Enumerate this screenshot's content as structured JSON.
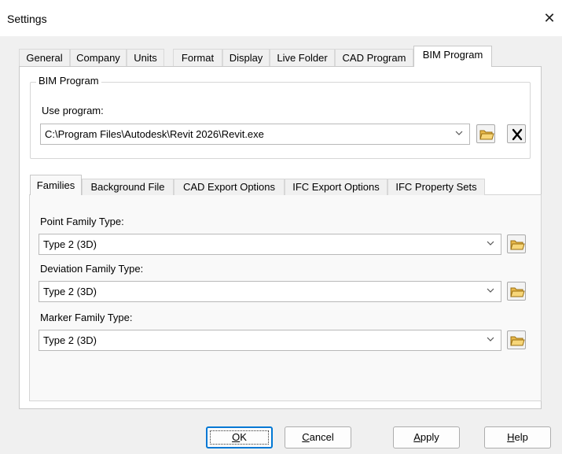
{
  "window": {
    "title": "Settings",
    "close_glyph": "✕"
  },
  "tabs": [
    "General",
    "Company",
    "Units",
    "Format",
    "Display",
    "Live Folder",
    "CAD Program",
    "BIM Program"
  ],
  "active_tab": "BIM Program",
  "bim_program": {
    "group_label": "BIM Program",
    "use_program_label": "Use program:",
    "program_path": "C:\\Program Files\\Autodesk\\Revit 2026\\Revit.exe"
  },
  "sub_tabs": [
    "Families",
    "Background File",
    "CAD Export Options",
    "IFC Export Options",
    "IFC Property Sets"
  ],
  "active_sub_tab": "Families",
  "families": {
    "point": {
      "label": "Point Family Type:",
      "value": "Type 2 (3D)"
    },
    "deviation": {
      "label": "Deviation Family Type:",
      "value": "Type 2 (3D)"
    },
    "marker": {
      "label": "Marker Family Type:",
      "value": "Type 2 (3D)"
    }
  },
  "buttons": {
    "ok": {
      "mnemonic": "O",
      "rest": "K"
    },
    "cancel": {
      "mnemonic": "C",
      "rest": "ancel"
    },
    "apply": {
      "mnemonic": "A",
      "rest": "pply"
    },
    "help": {
      "mnemonic": "H",
      "rest": "elp"
    }
  },
  "icons": {
    "browse": "folder-open-icon",
    "clear": "x-clear-icon",
    "dropdown": "chevron-down-icon"
  }
}
